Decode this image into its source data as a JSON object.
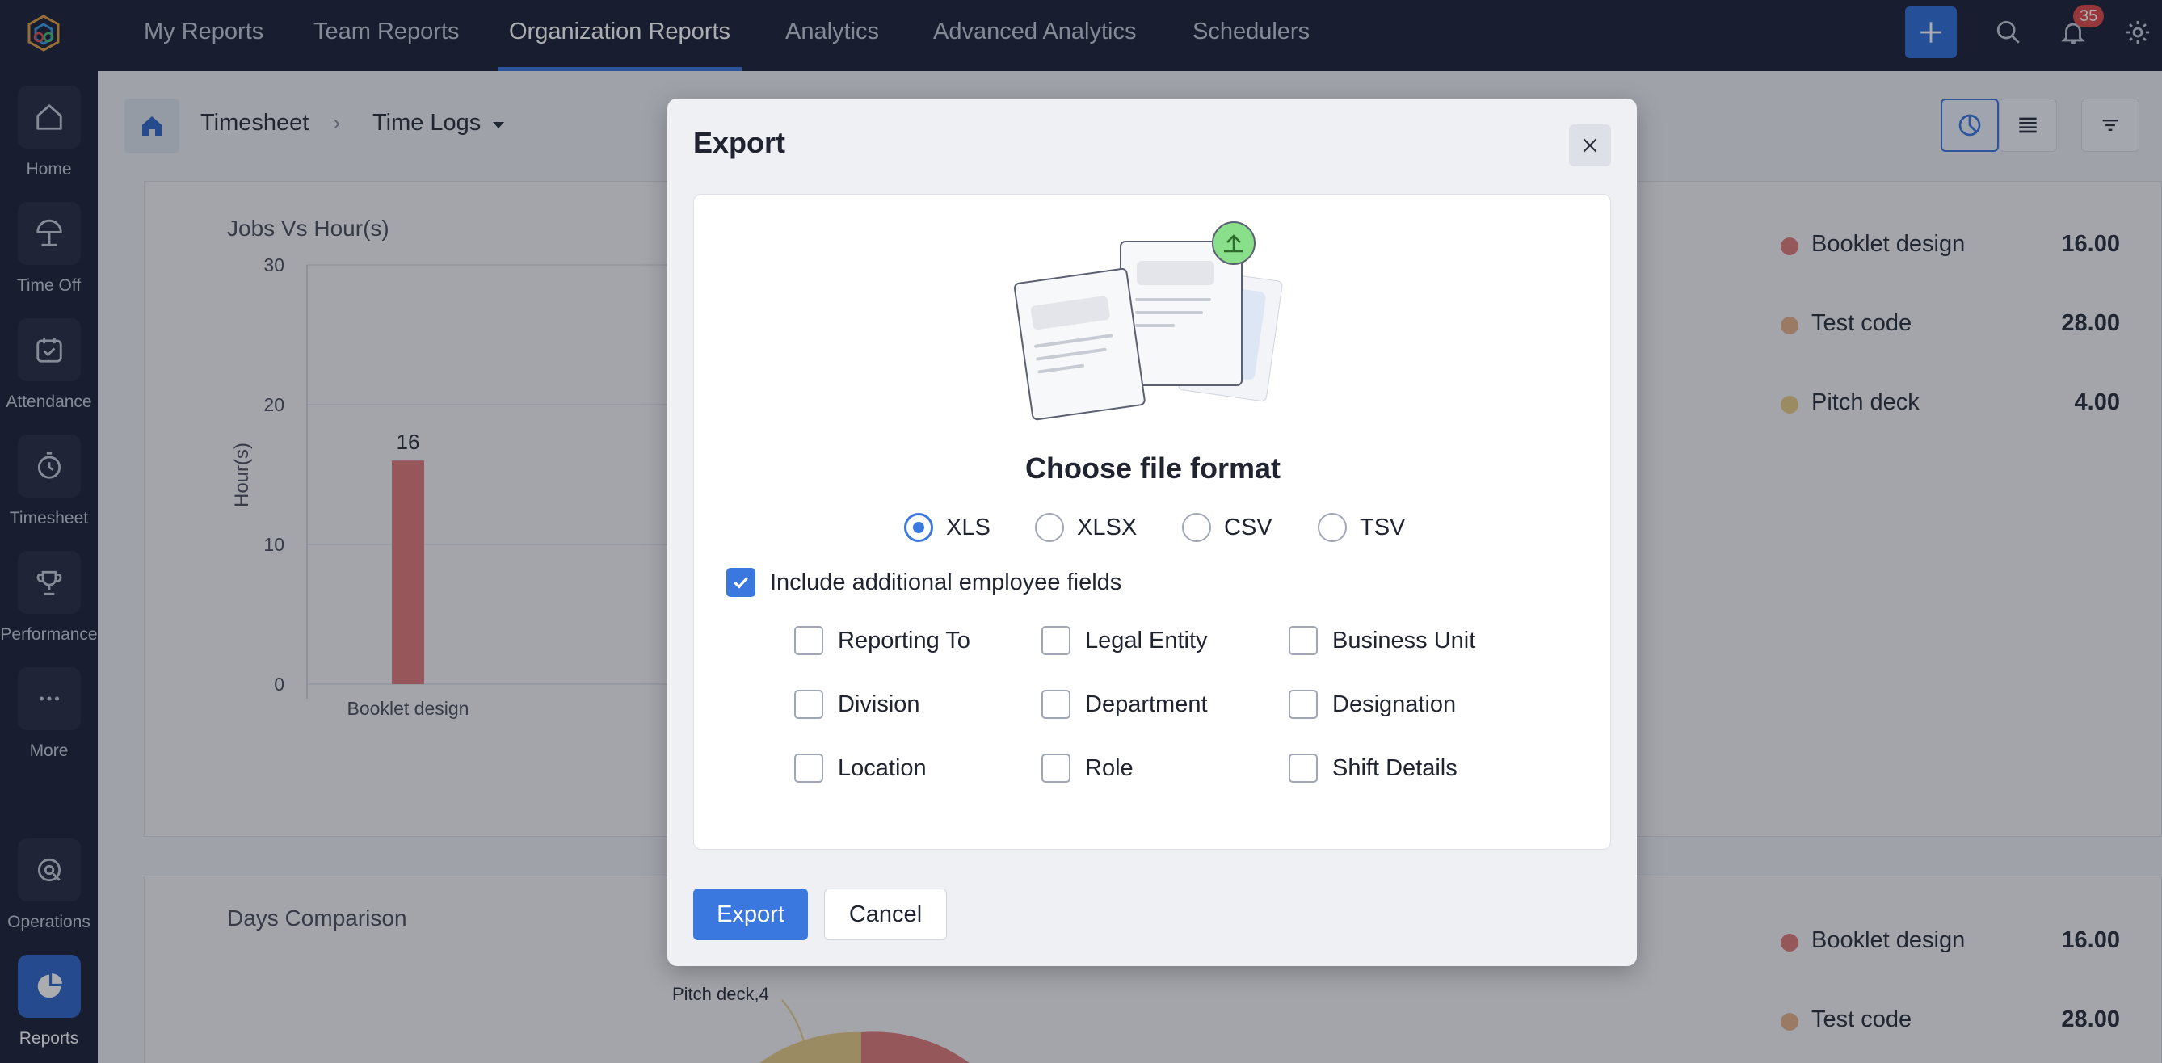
{
  "sidebar": {
    "items": [
      {
        "label": "Home",
        "icon": "home-icon"
      },
      {
        "label": "Time Off",
        "icon": "beach-umbrella-icon"
      },
      {
        "label": "Attendance",
        "icon": "calendar-check-icon"
      },
      {
        "label": "Timesheet",
        "icon": "stopwatch-icon"
      },
      {
        "label": "Performance",
        "icon": "trophy-icon"
      },
      {
        "label": "More",
        "icon": "more-dots-icon"
      },
      {
        "label": "Operations",
        "icon": "operations-icon"
      },
      {
        "label": "Reports",
        "icon": "pie-chart-icon"
      }
    ]
  },
  "topbar": {
    "tabs": [
      "My Reports",
      "Team Reports",
      "Organization Reports",
      "Analytics",
      "Advanced Analytics",
      "Schedulers"
    ],
    "active_tab": "Organization Reports",
    "notification_count": "35"
  },
  "breadcrumb": {
    "parent": "Timesheet",
    "current": "Time Logs"
  },
  "card1": {
    "title": "Jobs Vs Hour(s)",
    "legend": [
      {
        "name": "Booklet design",
        "value": "16.00",
        "color": "#e07a7a"
      },
      {
        "name": "Test code",
        "value": "28.00",
        "color": "#e6b08a"
      },
      {
        "name": "Pitch deck",
        "value": "4.00",
        "color": "#e8cc85"
      }
    ]
  },
  "card2": {
    "title": "Days Comparison",
    "pie_label": "Pitch deck,4",
    "legend": [
      {
        "name": "Booklet design",
        "value": "16.00",
        "color": "#e07a7a"
      },
      {
        "name": "Test code",
        "value": "28.00",
        "color": "#e6b08a"
      }
    ]
  },
  "chart_data": {
    "type": "bar",
    "title": "Jobs Vs Hour(s)",
    "ylabel": "Hour(s)",
    "xlabel": "",
    "categories": [
      "Booklet design"
    ],
    "values": [
      16
    ],
    "yticks": [
      0,
      10,
      20,
      30
    ],
    "ylim": [
      0,
      30
    ],
    "grid": true,
    "bar_color": "#e07a7a"
  },
  "modal": {
    "title": "Export",
    "subtitle": "Choose file format",
    "formats": [
      "XLS",
      "XLSX",
      "CSV",
      "TSV"
    ],
    "selected_format": "XLS",
    "include_fields_label": "Include additional employee fields",
    "include_fields_checked": true,
    "fields": [
      [
        "Reporting To",
        "Legal Entity",
        "Business Unit"
      ],
      [
        "Division",
        "Department",
        "Designation"
      ],
      [
        "Location",
        "Role",
        "Shift Details"
      ]
    ],
    "export_label": "Export",
    "cancel_label": "Cancel"
  }
}
